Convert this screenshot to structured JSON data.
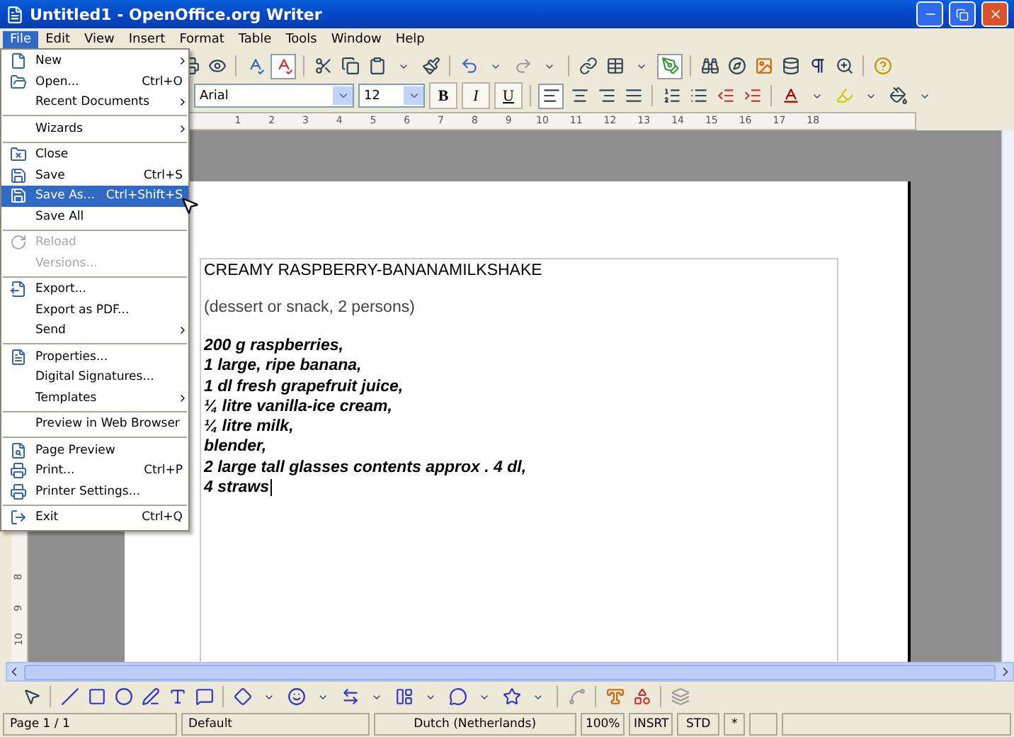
{
  "window": {
    "title": "Untitled1 - OpenOffice.org Writer"
  },
  "menubar": [
    {
      "label": "File",
      "selected": true
    },
    {
      "label": "Edit",
      "selected": false
    },
    {
      "label": "View",
      "selected": false
    },
    {
      "label": "Insert",
      "selected": false
    },
    {
      "label": "Format",
      "selected": false
    },
    {
      "label": "Table",
      "selected": false
    },
    {
      "label": "Tools",
      "selected": false
    },
    {
      "label": "Window",
      "selected": false
    },
    {
      "label": "Help",
      "selected": false
    }
  ],
  "file_menu": [
    {
      "kind": "item",
      "label": "New",
      "submenu": true,
      "disabled": false,
      "selected": false
    },
    {
      "kind": "item",
      "label": "Open...",
      "shortcut": "Ctrl+O",
      "submenu": false,
      "disabled": false,
      "selected": false
    },
    {
      "kind": "item",
      "label": "Recent Documents",
      "submenu": true,
      "disabled": false,
      "selected": false
    },
    {
      "kind": "separator"
    },
    {
      "kind": "item",
      "label": "Wizards",
      "submenu": true,
      "disabled": false,
      "selected": false
    },
    {
      "kind": "separator"
    },
    {
      "kind": "item",
      "label": "Close",
      "submenu": false,
      "disabled": false,
      "selected": false
    },
    {
      "kind": "item",
      "label": "Save",
      "shortcut": "Ctrl+S",
      "submenu": false,
      "disabled": false,
      "selected": false
    },
    {
      "kind": "item",
      "label": "Save As...",
      "shortcut": "Ctrl+Shift+S",
      "submenu": false,
      "disabled": false,
      "selected": true
    },
    {
      "kind": "item",
      "label": "Save All",
      "submenu": false,
      "disabled": false,
      "selected": false
    },
    {
      "kind": "separator"
    },
    {
      "kind": "item",
      "label": "Reload",
      "submenu": false,
      "disabled": true,
      "selected": false
    },
    {
      "kind": "item",
      "label": "Versions...",
      "submenu": false,
      "disabled": true,
      "selected": false
    },
    {
      "kind": "separator"
    },
    {
      "kind": "item",
      "label": "Export...",
      "submenu": false,
      "disabled": false,
      "selected": false
    },
    {
      "kind": "item",
      "label": "Export as PDF...",
      "submenu": false,
      "disabled": false,
      "selected": false
    },
    {
      "kind": "item",
      "label": "Send",
      "submenu": true,
      "disabled": false,
      "selected": false
    },
    {
      "kind": "separator"
    },
    {
      "kind": "item",
      "label": "Properties...",
      "submenu": false,
      "disabled": false,
      "selected": false
    },
    {
      "kind": "item",
      "label": "Digital Signatures...",
      "submenu": false,
      "disabled": false,
      "selected": false
    },
    {
      "kind": "item",
      "label": "Templates",
      "submenu": true,
      "disabled": false,
      "selected": false
    },
    {
      "kind": "separator"
    },
    {
      "kind": "item",
      "label": "Preview in Web Browser",
      "submenu": false,
      "disabled": false,
      "selected": false
    },
    {
      "kind": "separator"
    },
    {
      "kind": "item",
      "label": "Page Preview",
      "submenu": false,
      "disabled": false,
      "selected": false
    },
    {
      "kind": "item",
      "label": "Print...",
      "shortcut": "Ctrl+P",
      "submenu": false,
      "disabled": false,
      "selected": false
    },
    {
      "kind": "item",
      "label": "Printer Settings...",
      "submenu": false,
      "disabled": false,
      "selected": false
    },
    {
      "kind": "separator"
    },
    {
      "kind": "item",
      "label": "Exit",
      "shortcut": "Ctrl+Q",
      "submenu": false,
      "disabled": false,
      "selected": false
    }
  ],
  "formatting": {
    "font": "Arial",
    "size": "12",
    "bold": "B",
    "italic": "I",
    "underline": "U"
  },
  "ruler": {
    "marks": [
      "1",
      "2",
      "3",
      "4",
      "5",
      "6",
      "7",
      "8",
      "9",
      "10",
      "11",
      "12",
      "13",
      "14",
      "15",
      "16",
      "17",
      "18"
    ]
  },
  "vertical_ruler": {
    "marks": [
      "8",
      "9",
      "10"
    ]
  },
  "document": {
    "title": "CREAMY RASPBERRY-BANANAMILKSHAKE",
    "subtitle": "(dessert or snack, 2 persons)",
    "lines": [
      "200 g raspberries,",
      "1 large, ripe banana,",
      "1 dl fresh grapefruit juice,",
      "¼ litre vanilla-ice cream,",
      "¼ litre milk,",
      "blender,",
      "2 large tall glasses contents approx . 4 dl,",
      "4 straws"
    ]
  },
  "status_bar": [
    "Page 1 / 1",
    "Default",
    "Dutch (Netherlands)",
    "100%",
    "INSRT",
    "STD",
    "*"
  ]
}
